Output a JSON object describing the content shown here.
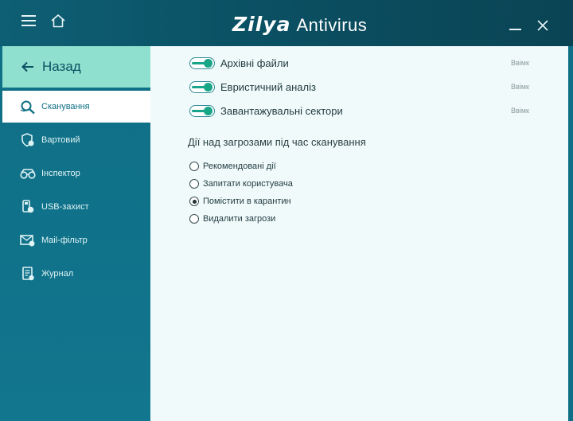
{
  "app": {
    "logo": "Zilya",
    "product": "Antivirus"
  },
  "sidebar": {
    "back_label": "Назад",
    "items": [
      {
        "label": "Сканування",
        "icon": "scan-icon",
        "active": true
      },
      {
        "label": "Вартовий",
        "icon": "guard-shield-icon",
        "active": false
      },
      {
        "label": "Інспектор",
        "icon": "inspector-binoculars-icon",
        "active": false
      },
      {
        "label": "USB-захист",
        "icon": "usb-shield-icon",
        "active": false
      },
      {
        "label": "Mail-фільтр",
        "icon": "mail-filter-icon",
        "active": false
      },
      {
        "label": "Журнал",
        "icon": "journal-icon",
        "active": false
      }
    ]
  },
  "settings": {
    "toggles": [
      {
        "label": "Архівні файли",
        "state": "Ввімк",
        "on": true
      },
      {
        "label": "Евристичний аналіз",
        "state": "Ввімк",
        "on": true
      },
      {
        "label": "Завантажувальні сектори",
        "state": "Ввімк",
        "on": true
      }
    ],
    "actions_title": "Дії над загрозами під час сканування",
    "actions": [
      {
        "label": "Рекомендовані дії",
        "checked": false
      },
      {
        "label": "Запитати користувача",
        "checked": false
      },
      {
        "label": "Помістити в карантин",
        "checked": true
      },
      {
        "label": "Видалити загрози",
        "checked": false
      }
    ]
  },
  "colors": {
    "accent": "#19a587",
    "sidebar": "#0f6f86",
    "back_button": "#8fe0cf",
    "content_bg": "#f1fafa"
  }
}
